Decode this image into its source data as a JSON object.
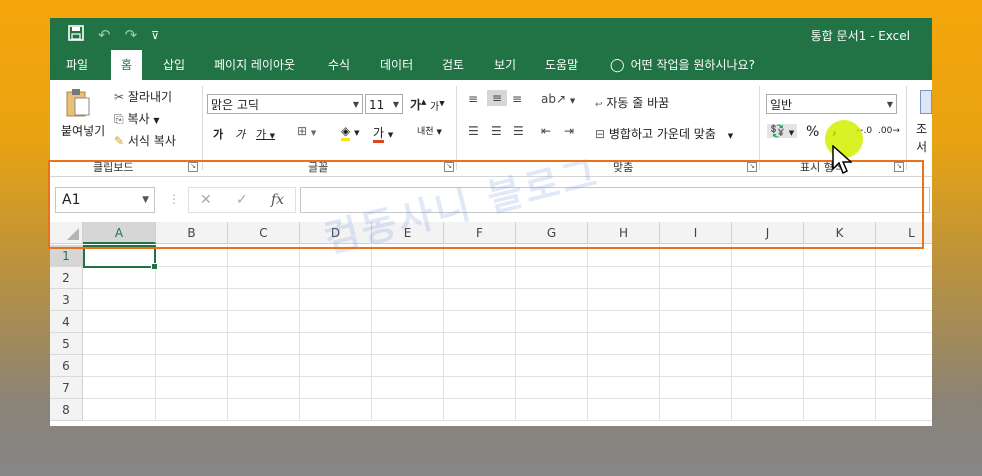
{
  "window": {
    "title": "통합 문서1  -  Excel"
  },
  "qat": {
    "save_icon": "save-icon",
    "undo": "↶",
    "redo": "↷",
    "customize": "⊽"
  },
  "menu": {
    "tabs": [
      "파일",
      "홈",
      "삽입",
      "페이지 레이아웃",
      "수식",
      "데이터",
      "검토",
      "보기",
      "도움말"
    ],
    "active": "홈",
    "tell_me": "어떤 작업을 원하시나요?"
  },
  "ribbon": {
    "clipboard": {
      "paste": "붙여넣기",
      "cut": "잘라내기",
      "copy": "복사",
      "format_painter": "서식 복사",
      "label": "클립보드"
    },
    "font": {
      "name": "맑은 고딕",
      "size": "11",
      "grow": "가",
      "shrink": "가",
      "bold": "가",
      "italic": "가",
      "underline": "가",
      "font_color": "가",
      "phonetic": "내천",
      "label": "글꼴"
    },
    "alignment": {
      "wrap": "자동 줄 바꿈",
      "merge": "병합하고 가운데 맞춤",
      "label": "맞춤"
    },
    "number": {
      "format": "일반",
      "percent": "%",
      "comma": ",",
      "label": "표시 형식"
    },
    "styles": {
      "conditional": "조",
      "format": "서"
    }
  },
  "formula_bar": {
    "name_box": "A1",
    "cancel": "✕",
    "enter": "✓",
    "fx": "fx",
    "formula": ""
  },
  "grid": {
    "columns": [
      "A",
      "B",
      "C",
      "D",
      "E",
      "F",
      "G",
      "H",
      "I",
      "J",
      "K",
      "L"
    ],
    "rows": [
      "1",
      "2",
      "3",
      "4",
      "5",
      "6",
      "7",
      "8"
    ],
    "active_cell": "A1"
  },
  "overlay": {
    "watermark": "컴동사니 블로그",
    "highlight_color": "#e8731a"
  },
  "colors": {
    "accent": "#217346"
  }
}
